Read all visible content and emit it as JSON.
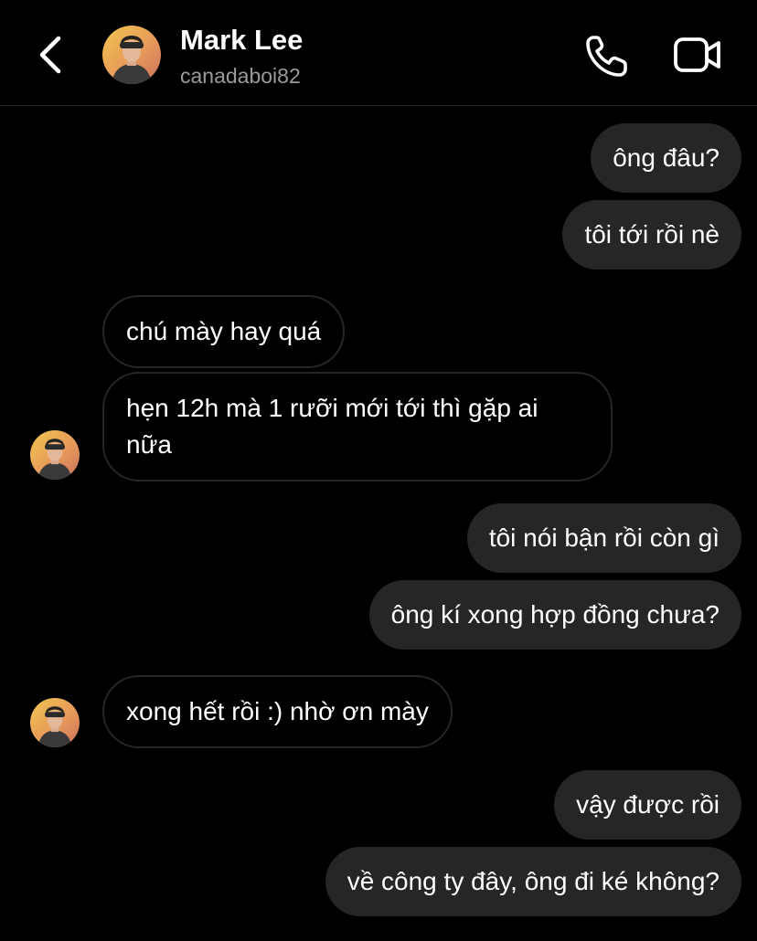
{
  "contact": {
    "name": "Mark Lee",
    "username": "canadaboi82"
  },
  "messages": [
    {
      "from": "me",
      "text": "ông đâu?"
    },
    {
      "from": "me",
      "text": "tôi tới rồi nè"
    },
    {
      "from": "them",
      "text": "chú mày hay quá"
    },
    {
      "from": "them",
      "text": "hẹn 12h mà 1 rưỡi mới tới thì gặp ai nữa"
    },
    {
      "from": "me",
      "text": "tôi nói bận rồi còn gì"
    },
    {
      "from": "me",
      "text": "ông kí xong hợp đồng chưa?"
    },
    {
      "from": "them",
      "text": "xong hết rồi :) nhờ ơn mày"
    },
    {
      "from": "me",
      "text": "vậy được rồi"
    },
    {
      "from": "me",
      "text": "về công ty đây, ông đi ké không?"
    }
  ],
  "icons": {
    "back": "chevron-left-icon",
    "call": "phone-icon",
    "video": "video-camera-icon"
  },
  "colors": {
    "background": "#000000",
    "outgoing_bubble": "#262626",
    "incoming_border": "#262626",
    "secondary_text": "#9a9a9a"
  }
}
